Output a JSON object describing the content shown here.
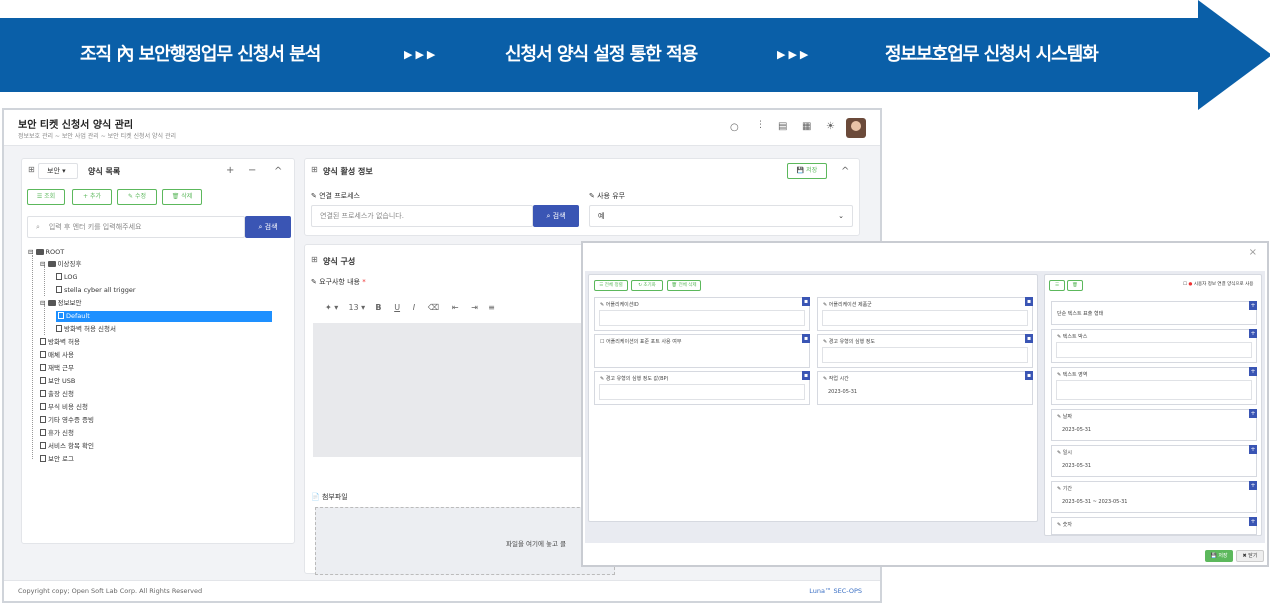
{
  "banner": {
    "step1": "조직 內 보안행정업무 신청서 분석",
    "step2": "신청서 양식 설정 통한 적용",
    "step3": "정보보호업무 신청서 시스템화",
    "chevron": "▶▶▶",
    "color": "#0a5fa8"
  },
  "app": {
    "title": "보안 티켓 신청서 양식 관리",
    "breadcrumb": "정보보호 관리 ~ 보안 사업 관리 ~ 보안 티켓 신청서 양식 관리"
  },
  "left_panel": {
    "category": "보안",
    "title": "양식 목록",
    "plus": "+",
    "minus": "−",
    "collapse": "^",
    "buttons": {
      "view": "조회",
      "add": "추가",
      "edit": "수정",
      "delete": "삭제"
    },
    "search_placeholder": "입력 후 엔터 키를 입력해주세요",
    "search_btn": "검색"
  },
  "tree": {
    "root": "ROOT",
    "group1": "이상징후",
    "g1_items": [
      "LOG",
      "stella cyber all trigger"
    ],
    "group2": "정보보안",
    "g2_items": [
      "Default",
      "방화벽 허용 신청서"
    ],
    "items": [
      "방화벽 허용",
      "매체 사용",
      "재택 근무",
      "보안 USB",
      "출장 신청",
      "부식 비용 신청",
      "기타 영수증 증빙",
      "휴가 신청",
      "서비스 항목 확인",
      "보안 로그"
    ]
  },
  "activation": {
    "title": "양식 활성 정보",
    "save": "저장",
    "process_label": "연결 프로세스",
    "process_placeholder": "연결된 프로세스가 없습니다.",
    "search": "검색",
    "use_label": "사용 유무",
    "use_value": "예"
  },
  "config": {
    "title": "양식 구성",
    "req_label": "요구사항 내용",
    "req_star": "*",
    "font_size": "13",
    "attach_label": "첨부파일",
    "drop_text": "파일을 여기에 놓고 클"
  },
  "footer": {
    "copyright": "Copyright copy; Open Soft Lab Corp. All Rights Reserved",
    "brand": "Luna™ SEC-OPS"
  },
  "modal": {
    "close": "×",
    "btns": {
      "b1": "전체 정렬",
      "b2": "초기화",
      "b3": "전체 삭제"
    },
    "option": "시용자 정보 연결 양식으로 사용",
    "fields": [
      {
        "t": "어플리케이션ID",
        "v": ""
      },
      {
        "t": "어플리케이션 제품군",
        "v": ""
      },
      {
        "t": "어플리케이션의 표준 포트 사용 여부",
        "v": ""
      },
      {
        "t": "경고 유형의 심행 정도",
        "v": ""
      },
      {
        "t": "경고 유형의 심행 정도 값(BP)",
        "v": ""
      },
      {
        "t": "작업 시간",
        "v": "2023-05-31"
      }
    ],
    "palette": [
      {
        "t": "단순 텍스트 표출 형태",
        "v": ""
      },
      {
        "t": "텍스트 박스",
        "v": ""
      },
      {
        "t": "텍스트 영역",
        "v": ""
      },
      {
        "t": "날짜",
        "v": "2023-05-31"
      },
      {
        "t": "일시",
        "v": "2023-05-31"
      },
      {
        "t": "기간",
        "v": "2023-05-31 ~ 2023-05-31"
      },
      {
        "t": "숫자",
        "v": ""
      }
    ],
    "save": "저장",
    "close_btn": "닫기"
  }
}
